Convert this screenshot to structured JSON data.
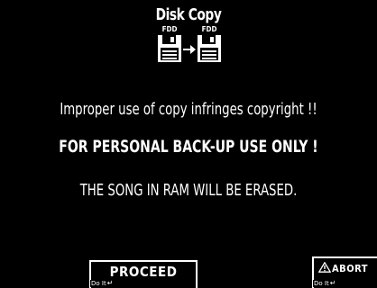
{
  "header": {
    "title": "Disk Copy"
  },
  "disks": {
    "source_label": "FDD",
    "dest_label": "FDD",
    "icons": [
      "floppy-disk-icon",
      "arrow-right-icon",
      "floppy-disk-icon"
    ]
  },
  "messages": {
    "line1": "Improper use of copy infringes copyright !!",
    "line2": "FOR PERSONAL BACK-UP USE ONLY !",
    "line3": "THE SONG IN RAM WILL BE ERASED."
  },
  "buttons": {
    "proceed_label": "PROCEED",
    "proceed_hint": "Do It",
    "abort_label": "ABORT",
    "abort_hint": "Do It",
    "abort_icon": "warning-triangle-icon",
    "hint_icon": "enter-key-icon"
  },
  "colors": {
    "background": "#000000",
    "foreground": "#ffffff"
  }
}
